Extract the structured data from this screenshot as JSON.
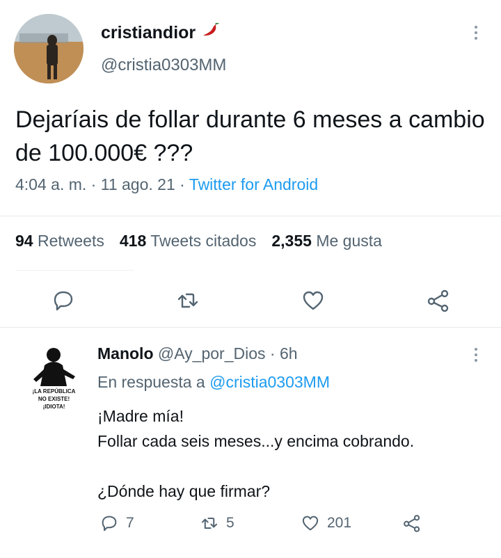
{
  "tweet": {
    "author": {
      "display_name": "cristiandior",
      "handle": "@cristia0303MM",
      "emoji": "chili-pepper-icon"
    },
    "text": "Dejaríais de follar durante 6 meses a cambio de 100.000€ ???",
    "meta": {
      "time": "4:04 a. m.",
      "separator": "·",
      "date": "11 ago. 21",
      "source": "Twitter for Android"
    },
    "stats": {
      "retweets_count": "94",
      "retweets_label": "Retweets",
      "quotes_count": "418",
      "quotes_label": "Tweets citados",
      "likes_count": "2,355",
      "likes_label": "Me gusta"
    },
    "actions": [
      "reply-icon",
      "retweet-icon",
      "like-icon",
      "share-icon"
    ]
  },
  "reply": {
    "author": {
      "display_name": "Manolo",
      "handle": "@Ay_por_Dios",
      "time": "6h",
      "separator": "·",
      "avatar_text_1": "¡LA REPÚBLICA",
      "avatar_text_2": "NO EXISTE!",
      "avatar_text_3": "¡IDIOTA!"
    },
    "in_reply_prefix": "En respuesta a",
    "in_reply_mention": "@cristia0303MM",
    "text": "¡Madre mía!\nFollar cada seis meses...y encima cobrando.\n\n¿Dónde hay que firmar?",
    "stats": {
      "replies": "7",
      "retweets": "5",
      "likes": "201"
    }
  },
  "colors": {
    "text": "#0f1419",
    "secondary": "#536471",
    "accent": "#1d9bf0",
    "divider": "#e6e9eb",
    "chili": "#c81e1e"
  }
}
